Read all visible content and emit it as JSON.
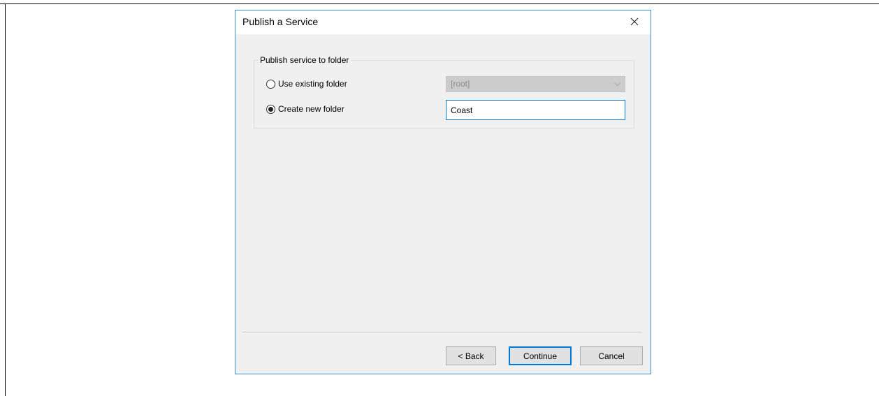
{
  "dialog": {
    "title": "Publish a Service",
    "close_icon": "close-icon",
    "group_label": "Publish service to folder",
    "options": {
      "existing_label": "Use existing folder",
      "existing_selected": false,
      "existing_value": "[root]",
      "new_label": "Create new folder",
      "new_selected": true,
      "new_value": "Coast"
    },
    "buttons": {
      "back": "< Back",
      "continue": "Continue",
      "cancel": "Cancel"
    }
  }
}
